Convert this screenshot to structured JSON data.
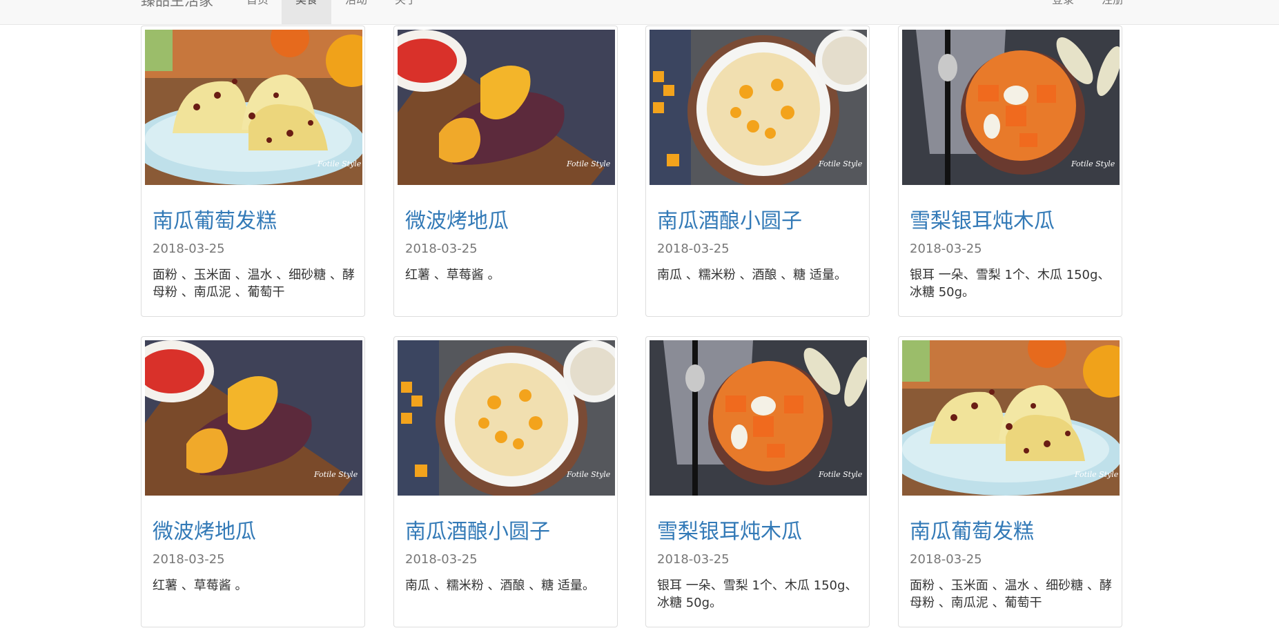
{
  "navbar": {
    "brand": "臻品生活家",
    "items": [
      {
        "label": "首页",
        "active": false
      },
      {
        "label": "美食",
        "active": true
      },
      {
        "label": "活动",
        "active": false
      },
      {
        "label": "关于",
        "active": false
      }
    ],
    "login": "登录",
    "register": "注册"
  },
  "cards": [
    {
      "image": "steamed-cake-image",
      "title": "南瓜葡萄发糕",
      "date": "2018-03-25",
      "desc": "面粉 、玉米面 、温水 、细砂糖 、酵母粉 、南瓜泥 、葡萄干"
    },
    {
      "image": "sweet-potato-image",
      "title": "微波烤地瓜",
      "date": "2018-03-25",
      "desc": "红薯 、草莓酱 。"
    },
    {
      "image": "pumpkin-rice-ball-soup-image",
      "title": "南瓜酒酿小圆子",
      "date": "2018-03-25",
      "desc": "南瓜 、糯米粉 、酒酿 、糖 适量。"
    },
    {
      "image": "pear-papaya-soup-image",
      "title": "雪梨银耳炖木瓜",
      "date": "2018-03-25",
      "desc": "银耳 一朵、雪梨 1个、木瓜 150g、冰糖 50g。"
    },
    {
      "image": "sweet-potato-image",
      "title": "微波烤地瓜",
      "date": "2018-03-25",
      "desc": "红薯 、草莓酱 。"
    },
    {
      "image": "pumpkin-rice-ball-soup-image",
      "title": "南瓜酒酿小圆子",
      "date": "2018-03-25",
      "desc": "南瓜 、糯米粉 、酒酿 、糖 适量。"
    },
    {
      "image": "pear-papaya-soup-image",
      "title": "雪梨银耳炖木瓜",
      "date": "2018-03-25",
      "desc": "银耳 一朵、雪梨 1个、木瓜 150g、冰糖 50g。"
    },
    {
      "image": "steamed-cake-image",
      "title": "南瓜葡萄发糕",
      "date": "2018-03-25",
      "desc": "面粉 、玉米面 、温水 、细砂糖 、酵母粉 、南瓜泥 、葡萄干"
    }
  ],
  "watermark": "Fotile Style"
}
